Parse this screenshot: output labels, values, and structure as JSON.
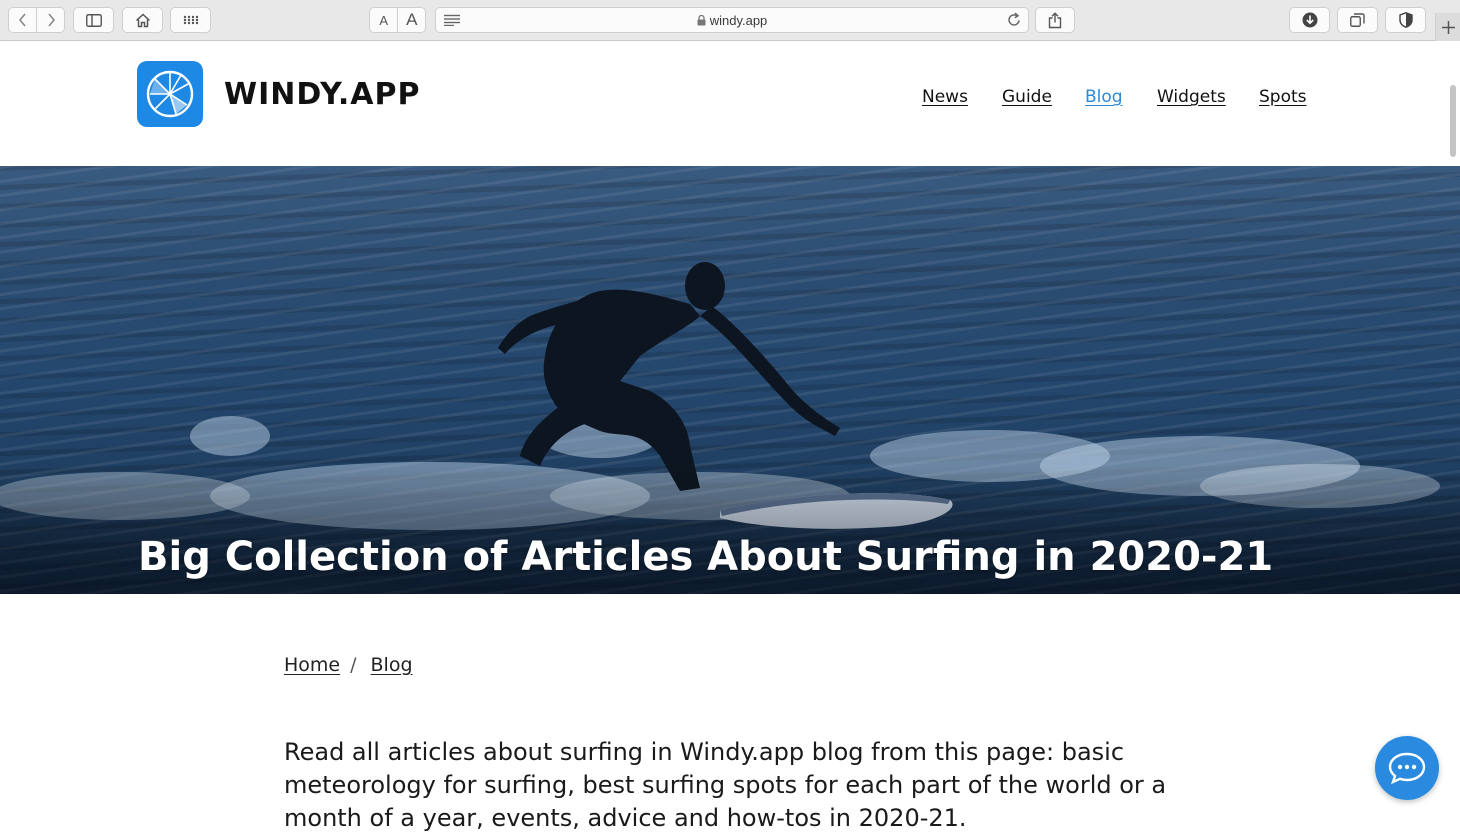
{
  "browser": {
    "url": "windy.app",
    "font_small": "A",
    "font_large": "A"
  },
  "site": {
    "logo_text": "WINDY.APP",
    "brand_color": "#1e88e5",
    "nav": [
      {
        "label": "News",
        "active": false
      },
      {
        "label": "Guide",
        "active": false
      },
      {
        "label": "Blog",
        "active": true
      },
      {
        "label": "Widgets",
        "active": false
      },
      {
        "label": "Spots",
        "active": false
      }
    ]
  },
  "hero": {
    "title": "Big Collection of Articles About Surfing in 2020-21"
  },
  "breadcrumb": {
    "home": "Home",
    "separator": "/",
    "current": "Blog"
  },
  "intro": {
    "text": "Read all articles about surfing in Windy.app blog from this page: basic meteorology for surfing, best surfing spots for each part of the world or a month of a year, events, advice and how-tos in 2020-21."
  },
  "icons": {
    "back": "chevron-left-icon",
    "forward": "chevron-right-icon",
    "sidebar": "sidebar-icon",
    "home": "home-icon",
    "grid": "grid-icon",
    "reader": "reader-icon",
    "lock": "lock-icon",
    "reload": "reload-icon",
    "share": "share-icon",
    "download": "download-icon",
    "tabs": "tabs-icon",
    "shield": "shield-icon",
    "plus": "plus-icon",
    "chat": "chat-icon"
  }
}
